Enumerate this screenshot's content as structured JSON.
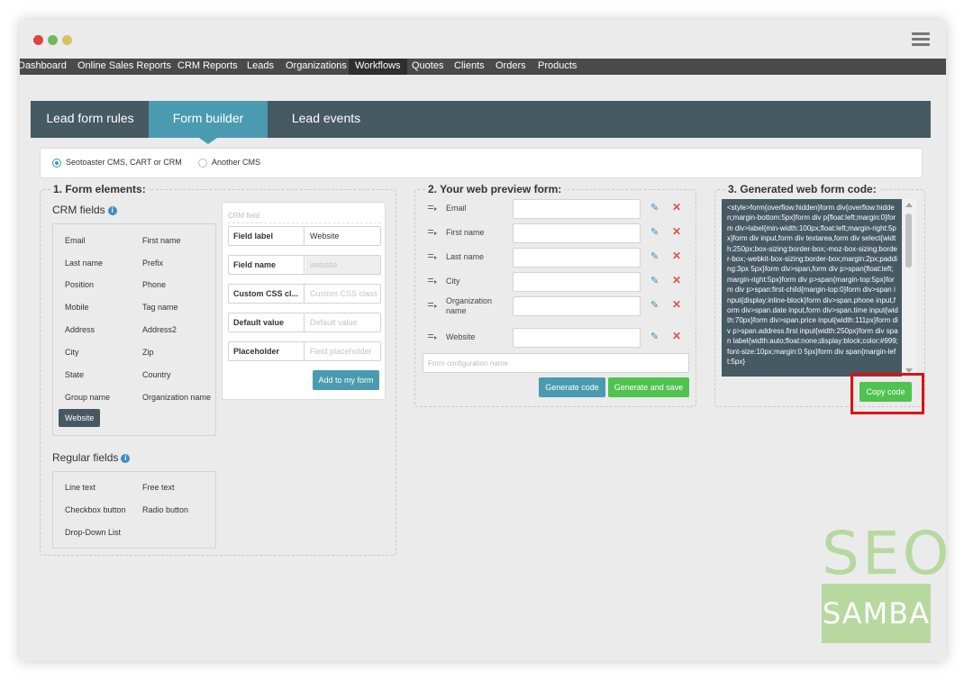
{
  "window": {
    "traffic_lights": [
      {
        "name": "close",
        "color": "#e0443e"
      },
      {
        "name": "minimize",
        "color": "#6fb85b"
      },
      {
        "name": "zoom",
        "color": "#d7c35e"
      }
    ],
    "menu_icon": "hamburger-menu-icon"
  },
  "topnav": {
    "items": [
      "Dashboard",
      "Online Sales Reports",
      "CRM Reports",
      "Leads",
      "Organizations",
      "Workflows",
      "Quotes",
      "Clients",
      "Orders",
      "Products"
    ],
    "active": "Workflows"
  },
  "tabs": {
    "items": [
      "Lead form rules",
      "Form builder",
      "Lead events"
    ],
    "active": "Form builder"
  },
  "cms": {
    "options": [
      "Seotoaster CMS, CART or CRM",
      "Another CMS"
    ],
    "selected": "Seotoaster CMS, CART or CRM"
  },
  "form_elements": {
    "title": "1. Form elements:",
    "crm_title": "CRM fields",
    "crm_fields": [
      "Email",
      "First name",
      "Last name",
      "Prefix",
      "Position",
      "Phone",
      "Mobile",
      "Tag name",
      "Address",
      "Address2",
      "City",
      "Zip",
      "State",
      "Country",
      "Group name",
      "Organization name",
      "Website"
    ],
    "selected_field": "Website",
    "regular_title": "Regular fields",
    "regular_fields": [
      "Line text",
      "Free text",
      "Checkbox button",
      "Radio button",
      "Drop-Down List"
    ]
  },
  "crm_field_panel": {
    "title": "CRM field",
    "rows": [
      {
        "label": "Field label",
        "value": "Website",
        "placeholder": ""
      },
      {
        "label": "Field name",
        "value": "",
        "placeholder": "website"
      },
      {
        "label": "Custom CSS cl...",
        "value": "",
        "placeholder": "Custom CSS class"
      },
      {
        "label": "Default value",
        "value": "",
        "placeholder": "Default value"
      },
      {
        "label": "Placeholder",
        "value": "",
        "placeholder": "Field placeholder"
      }
    ],
    "add_button": "Add to my form"
  },
  "preview": {
    "title": "2. Your web preview form:",
    "fields": [
      "Email",
      "First name",
      "Last name",
      "City",
      "Organization name",
      "Website"
    ],
    "config_placeholder": "Form configuration name",
    "generate_button": "Generate code",
    "generate_save_button": "Generate and save",
    "edit_icon": "pencil-icon",
    "delete_icon": "delete-x-icon",
    "drag_icon": "drag-handle-icon"
  },
  "generated": {
    "title": "3. Generated web form code:",
    "code": "<style>form{overflow:hidden}form div{overflow:hidden;margin-bottom:5px}form div p{float:left;margin:0}form div>label{min-width:100px;float:left;margin-right:5px}form div input,form div textarea,form div select{width:250px;box-sizing:border-box;-moz-box-sizing:border-box;-webkit-box-sizing:border-box;margin:2px;padding:3px 5px}form div>span,form div p>span{float:left;margin-right:5px}form div p>span{margin-top:5px}form div p>span:first-child{margin-top:0}form div>span input{display:inline-block}form div>span.phone input,form div>span.date input,form div>span.time input{width:70px}form div>span.price input{width:111px}form div p>span.address.first input{width:250px}form div span label{width:auto;float:none;display:block;color:#999;font-size:10px;margin:0 5px}form div span{margin-left:5px}",
    "copy_button": "Copy code"
  },
  "logo": {
    "top": "SEO",
    "bottom": "SAMBA"
  },
  "colors": {
    "accent": "#4a9bb0",
    "tab_bar": "#465a63",
    "green": "#4fc24f",
    "highlight": "#dd1111"
  }
}
